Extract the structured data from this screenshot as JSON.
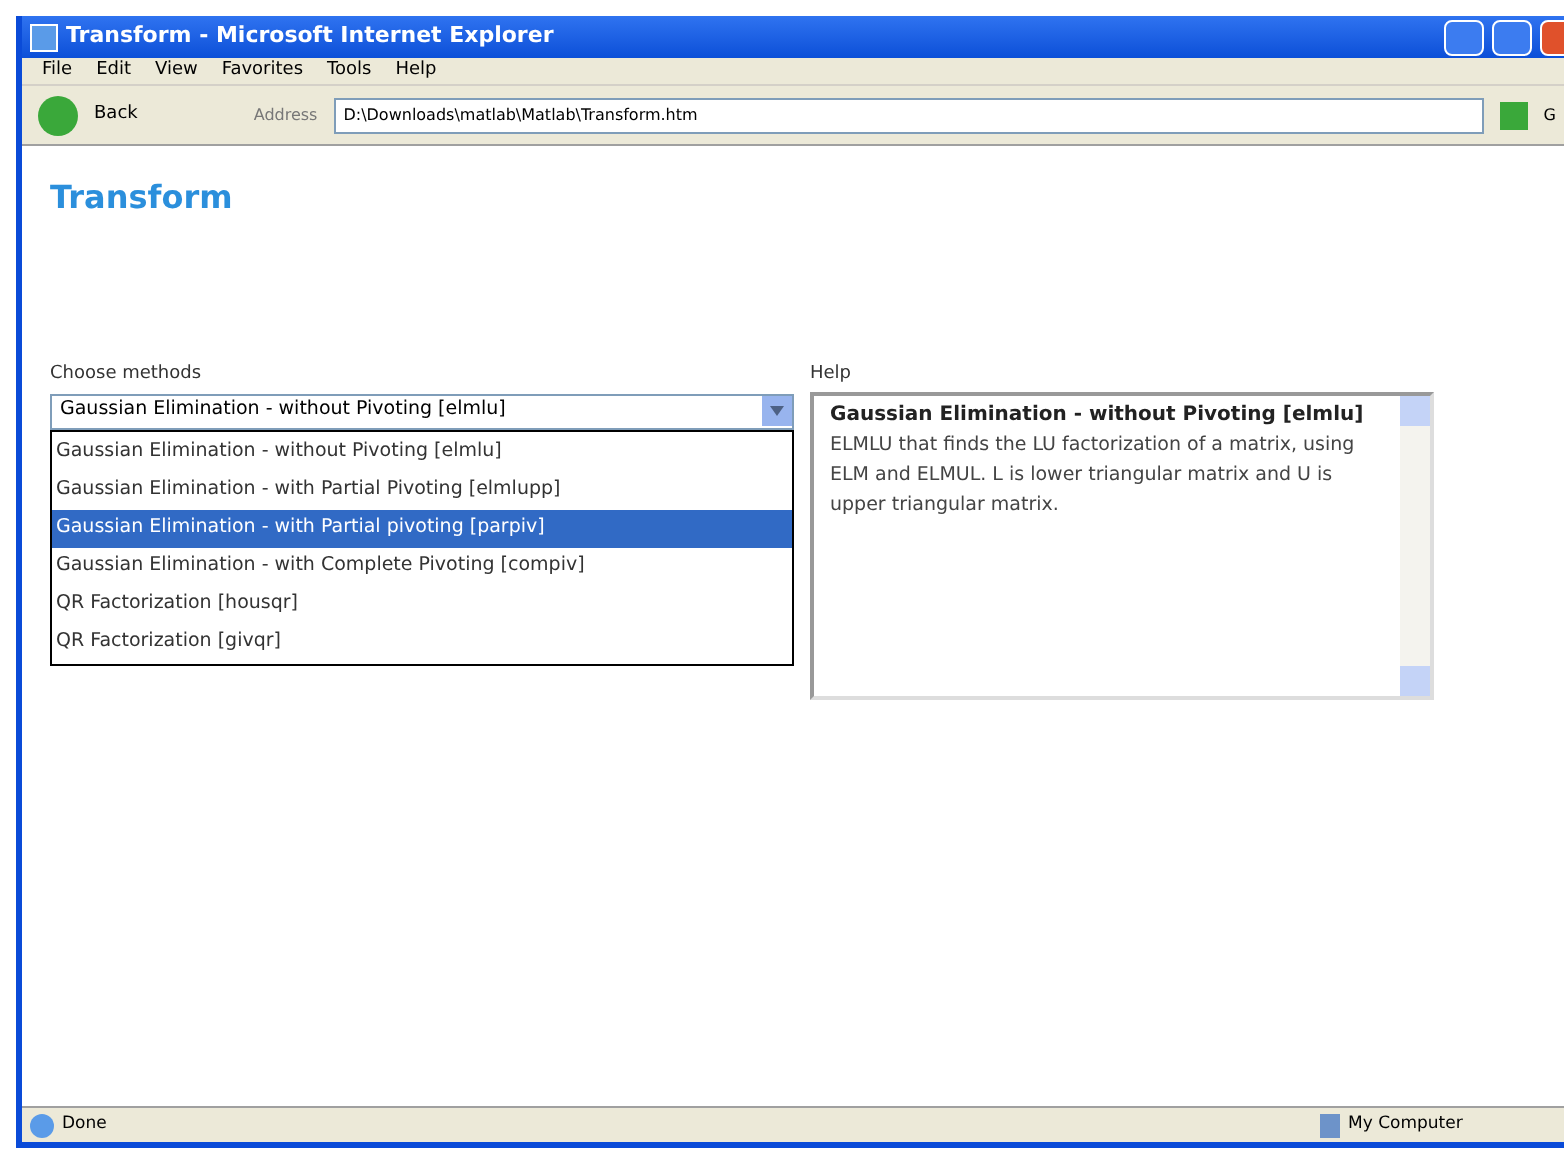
{
  "window": {
    "title": "Transform - Microsoft Internet Explorer"
  },
  "menu": [
    "File",
    "Edit",
    "View",
    "Favorites",
    "Tools",
    "Help"
  ],
  "toolbar": {
    "back": "Back",
    "address_label": "Address",
    "address": "D:\\Downloads\\matlab\\Matlab\\Transform.htm",
    "go": "G"
  },
  "page": {
    "heading": "Transform",
    "methods": {
      "label": "Choose methods",
      "value": "Gaussian Elimination - without Pivoting [elmlu]",
      "expanded": true,
      "options": [
        {
          "label": "Gaussian Elimination - without Pivoting [elmlu]",
          "highlighted": false
        },
        {
          "label": "Gaussian Elimination - with Partial Pivoting [elmlupp]",
          "highlighted": false
        },
        {
          "label": "Gaussian Elimination - with Partial pivoting [parpiv]",
          "highlighted": true
        },
        {
          "label": "Gaussian Elimination - with Complete Pivoting [compiv]",
          "highlighted": false
        },
        {
          "label": "QR Factorization [housqr]",
          "highlighted": false
        },
        {
          "label": "QR Factorization [givqr]",
          "highlighted": false
        }
      ]
    },
    "help": {
      "label": "Help",
      "title": "Gaussian Elimination - without Pivoting [elmlu]",
      "text": "ELMLU that finds the LU factorization of a matrix, using ELM and ELMUL. L is lower triangular matrix and U is upper triangular matrix."
    }
  },
  "status_bar": {
    "status": "Done",
    "zone": "My Computer"
  }
}
